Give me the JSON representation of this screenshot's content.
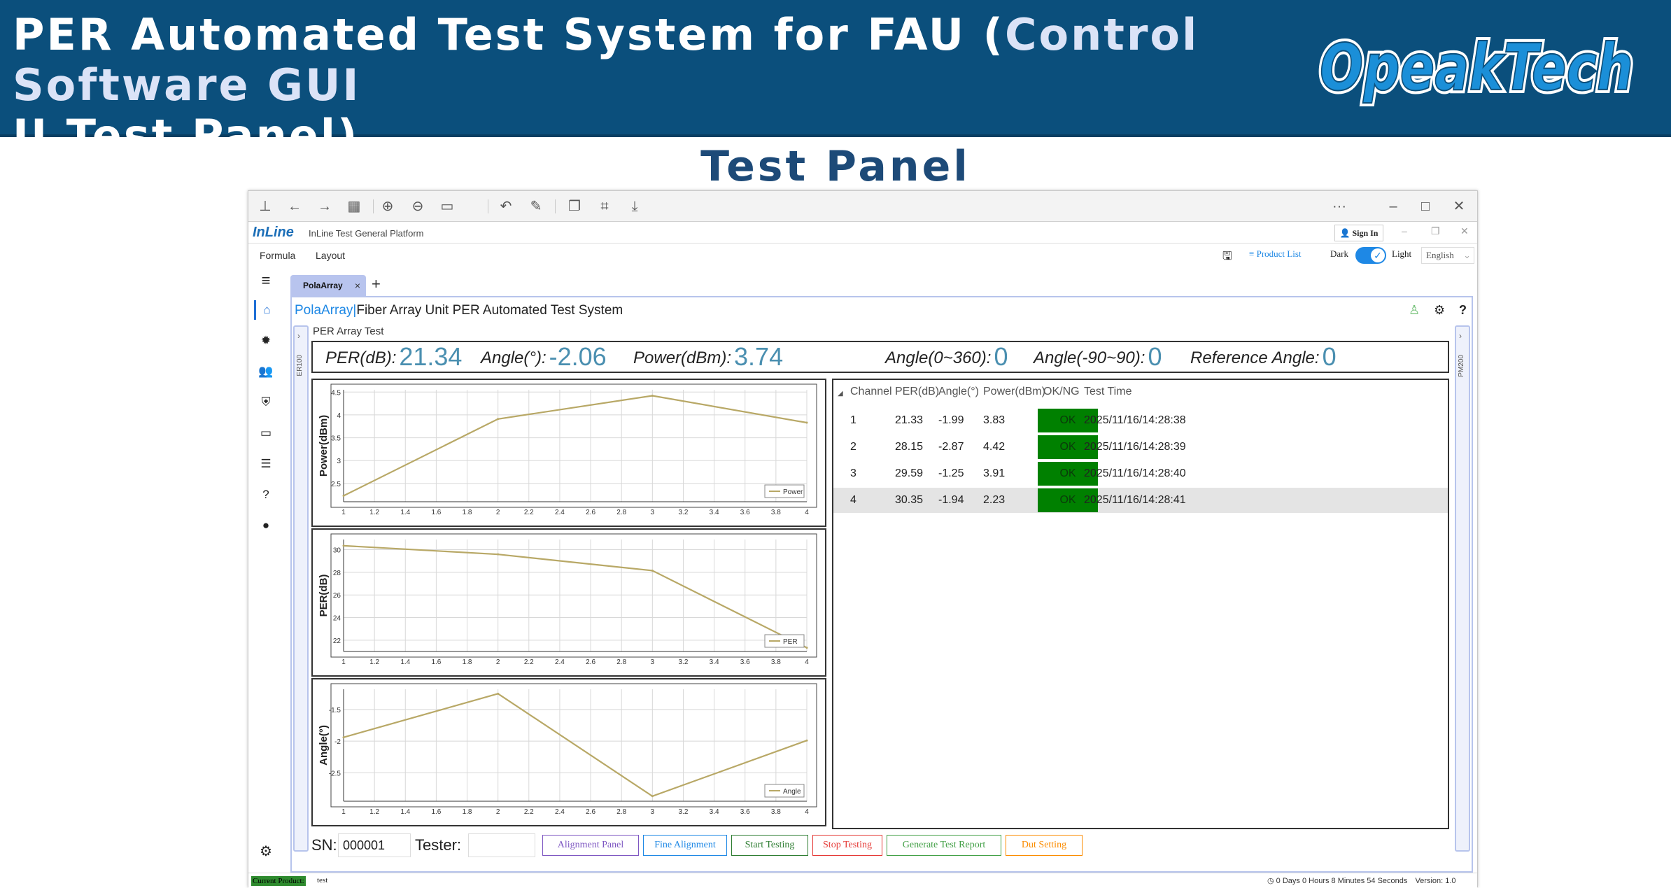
{
  "banner": {
    "title_main": "PER Automated Test System for FAU (",
    "title_highlight": "Control Software GUI",
    "title_line2": "II Test Panel)",
    "logo_text": "OpeakTech"
  },
  "heading": "Test Panel",
  "chrome": {
    "icons": [
      "pin-icon",
      "back-icon",
      "forward-icon",
      "grid-icon",
      "zoom-in-icon",
      "zoom-out-icon",
      "fit-icon",
      "rotate-icon",
      "edit-icon",
      "copy-icon",
      "crop-icon",
      "save-icon"
    ],
    "more": "···"
  },
  "app": {
    "logo": "InLine",
    "name": "InLine Test General Platform",
    "sign_in": "Sign In",
    "menu": [
      "Formula",
      "Layout"
    ],
    "product_list": "Product List",
    "dark": "Dark",
    "light": "Light",
    "language": "English"
  },
  "tab": {
    "label": "PolaArray",
    "close": "×",
    "add": "+"
  },
  "panel": {
    "brand": "PolaArray",
    "title": "Fiber Array Unit PER Automated Test System",
    "left_rail": "ER100",
    "right_rail": "PM200",
    "group_label": "PER Array Test"
  },
  "readouts": [
    {
      "label": "PER(dB):",
      "value": "21.34"
    },
    {
      "label": "Angle(°):",
      "value": "-2.06"
    },
    {
      "label": "Power(dBm):",
      "value": "3.74"
    },
    {
      "label": "Angle(0~360):",
      "value": "0"
    },
    {
      "label": "Angle(-90~90):",
      "value": "0"
    },
    {
      "label": "Reference Angle:",
      "value": "0"
    }
  ],
  "chart_data": [
    {
      "type": "line",
      "ylabel": "Power(dBm)",
      "x": [
        1,
        2,
        3,
        4
      ],
      "series": [
        {
          "name": "Power",
          "values": [
            2.23,
            3.91,
            4.42,
            3.83
          ]
        }
      ],
      "xlim": [
        1,
        4
      ],
      "ylim": [
        2.1,
        4.55
      ],
      "xticks": [
        "1",
        "1.2",
        "1.4",
        "1.6",
        "1.8",
        "2",
        "2.2",
        "2.4",
        "2.6",
        "2.8",
        "3",
        "3.2",
        "3.4",
        "3.6",
        "3.8",
        "4"
      ],
      "yticks": [
        "2.5",
        "3",
        "3.5",
        "4",
        "4.5"
      ],
      "grid": true,
      "legend": "bottom-right"
    },
    {
      "type": "line",
      "ylabel": "PER(dB)",
      "x": [
        1,
        2,
        3,
        4
      ],
      "series": [
        {
          "name": "PER",
          "values": [
            30.35,
            29.59,
            28.15,
            21.33
          ]
        }
      ],
      "xlim": [
        1,
        4
      ],
      "ylim": [
        21,
        30.9
      ],
      "xticks": [
        "1",
        "1.2",
        "1.4",
        "1.6",
        "1.8",
        "2",
        "2.2",
        "2.4",
        "2.6",
        "2.8",
        "3",
        "3.2",
        "3.4",
        "3.6",
        "3.8",
        "4"
      ],
      "yticks": [
        "22",
        "24",
        "26",
        "28",
        "30"
      ],
      "grid": true,
      "legend": "bottom-right"
    },
    {
      "type": "line",
      "ylabel": "Angle(°)",
      "x": [
        1,
        2,
        3,
        4
      ],
      "series": [
        {
          "name": "Angle",
          "values": [
            -1.94,
            -1.25,
            -2.87,
            -1.99
          ]
        }
      ],
      "xlim": [
        1,
        4
      ],
      "ylim": [
        -2.95,
        -1.18
      ],
      "xticks": [
        "1",
        "1.2",
        "1.4",
        "1.6",
        "1.8",
        "2",
        "2.2",
        "2.4",
        "2.6",
        "2.8",
        "3",
        "3.2",
        "3.4",
        "3.6",
        "3.8",
        "4"
      ],
      "yticks": [
        "-1.5",
        "-2",
        "-2.5"
      ],
      "grid": true,
      "legend": "bottom-right"
    }
  ],
  "table": {
    "columns": [
      "Channel",
      "PER(dB)",
      "Angle(°)",
      "Power(dBm)",
      "OK/NG",
      "Test Time"
    ],
    "rows": [
      {
        "channel": "1",
        "per": "21.33",
        "angle": "-1.99",
        "power": "3.83",
        "status": "OK",
        "time": "2025/11/16/14:28:38"
      },
      {
        "channel": "2",
        "per": "28.15",
        "angle": "-2.87",
        "power": "4.42",
        "status": "OK",
        "time": "2025/11/16/14:28:39"
      },
      {
        "channel": "3",
        "per": "29.59",
        "angle": "-1.25",
        "power": "3.91",
        "status": "OK",
        "time": "2025/11/16/14:28:40"
      },
      {
        "channel": "4",
        "per": "30.35",
        "angle": "-1.94",
        "power": "2.23",
        "status": "OK",
        "time": "2025/11/16/14:28:41"
      }
    ],
    "selected_row": 4
  },
  "bottom": {
    "sn_label": "SN:",
    "sn_value": "000001",
    "tester_label": "Tester:",
    "tester_value": "",
    "buttons": [
      {
        "label": "Alignment Panel",
        "color": "#7e57c2"
      },
      {
        "label": "Fine Alignment",
        "color": "#1e88e5"
      },
      {
        "label": "Start Testing",
        "color": "#2e7d32"
      },
      {
        "label": "Stop Testing",
        "color": "#e53935"
      },
      {
        "label": "Generate Test Report",
        "color": "#43a047"
      },
      {
        "label": "Dut Setting",
        "color": "#fb8c00"
      }
    ]
  },
  "status": {
    "current_product_label": "Current Product:",
    "current_product_value": "test",
    "uptime": "0 Days 0 Hours 8 Minutes 54 Seconds",
    "version": "Version: 1.0"
  },
  "colors": {
    "banner": "#0b4f7c",
    "accent": "#1e88e5",
    "chart_line": "#b8a866",
    "ok_status": "#008000",
    "panel_border": "#b7c4ec"
  }
}
